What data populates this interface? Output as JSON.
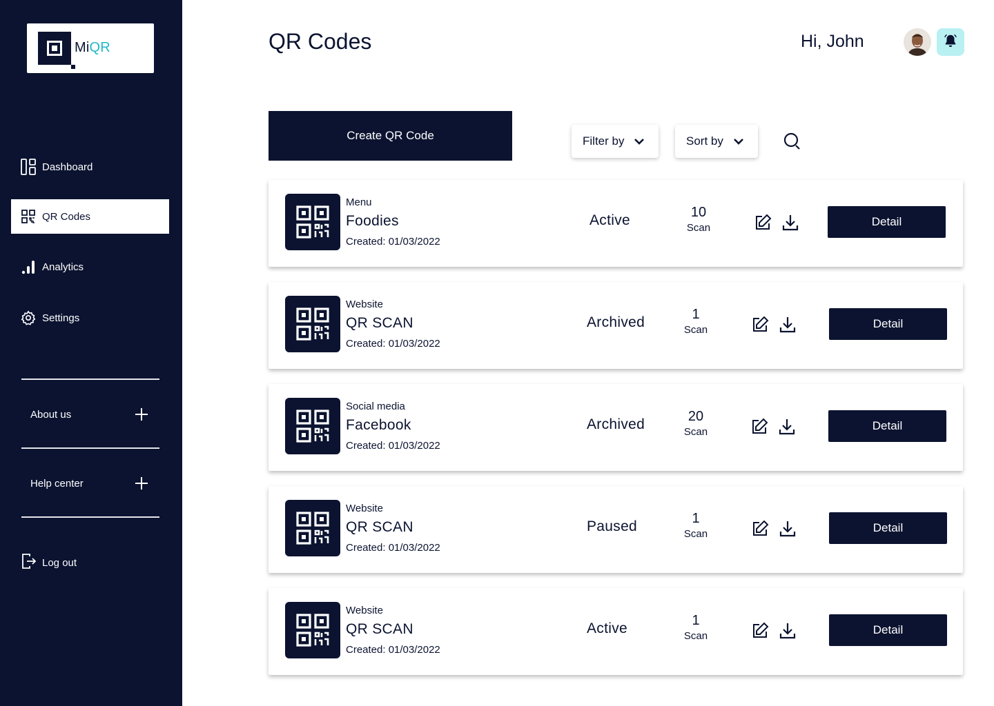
{
  "brand": {
    "name_part1": "Mi",
    "name_part2": "QR",
    "accent": "#20b8c8",
    "navy": "#0b1330"
  },
  "sidebar": {
    "items": [
      {
        "label": "Dashboard",
        "icon": "dashboard-icon",
        "active": false
      },
      {
        "label": "QR Codes",
        "icon": "qr-grid-icon",
        "active": true
      },
      {
        "label": "Analytics",
        "icon": "bar-chart-icon",
        "active": false
      },
      {
        "label": "Settings",
        "icon": "gear-icon",
        "active": false
      }
    ],
    "accordion": [
      {
        "label": "About us",
        "icon": "plus-icon"
      },
      {
        "label": "Help center",
        "icon": "plus-icon"
      }
    ],
    "logout": {
      "label": "Log out",
      "icon": "logout-icon"
    }
  },
  "header": {
    "title": "QR Codes",
    "greeting": "Hi, John",
    "avatar": "user-avatar",
    "notification_icon": "bell-icon",
    "notification_bg": "#b9f0f2"
  },
  "toolbar": {
    "create_label": "Create QR Code",
    "filter_label": "Filter by",
    "sort_label": "Sort by",
    "search_icon": "search-icon"
  },
  "qr_list": [
    {
      "type": "Menu",
      "name": "Foodies",
      "created": "Created: 01/03/2022",
      "status": "Active",
      "scans": "10",
      "scan_label": "Scan",
      "detail_label": "Detail"
    },
    {
      "type": "Website",
      "name": "QR SCAN",
      "created": "Created: 01/03/2022",
      "status": "Archived",
      "scans": "1",
      "scan_label": "Scan",
      "detail_label": "Detail"
    },
    {
      "type": "Social media",
      "name": "Facebook",
      "created": "Created: 01/03/2022",
      "status": "Archived",
      "scans": "20",
      "scan_label": "Scan",
      "detail_label": "Detail"
    },
    {
      "type": "Website",
      "name": "QR SCAN",
      "created": "Created: 01/03/2022",
      "status": "Paused",
      "scans": "1",
      "scan_label": "Scan",
      "detail_label": "Detail"
    },
    {
      "type": "Website",
      "name": "QR SCAN",
      "created": "Created: 01/03/2022",
      "status": "Active",
      "scans": "1",
      "scan_label": "Scan",
      "detail_label": "Detail"
    }
  ]
}
